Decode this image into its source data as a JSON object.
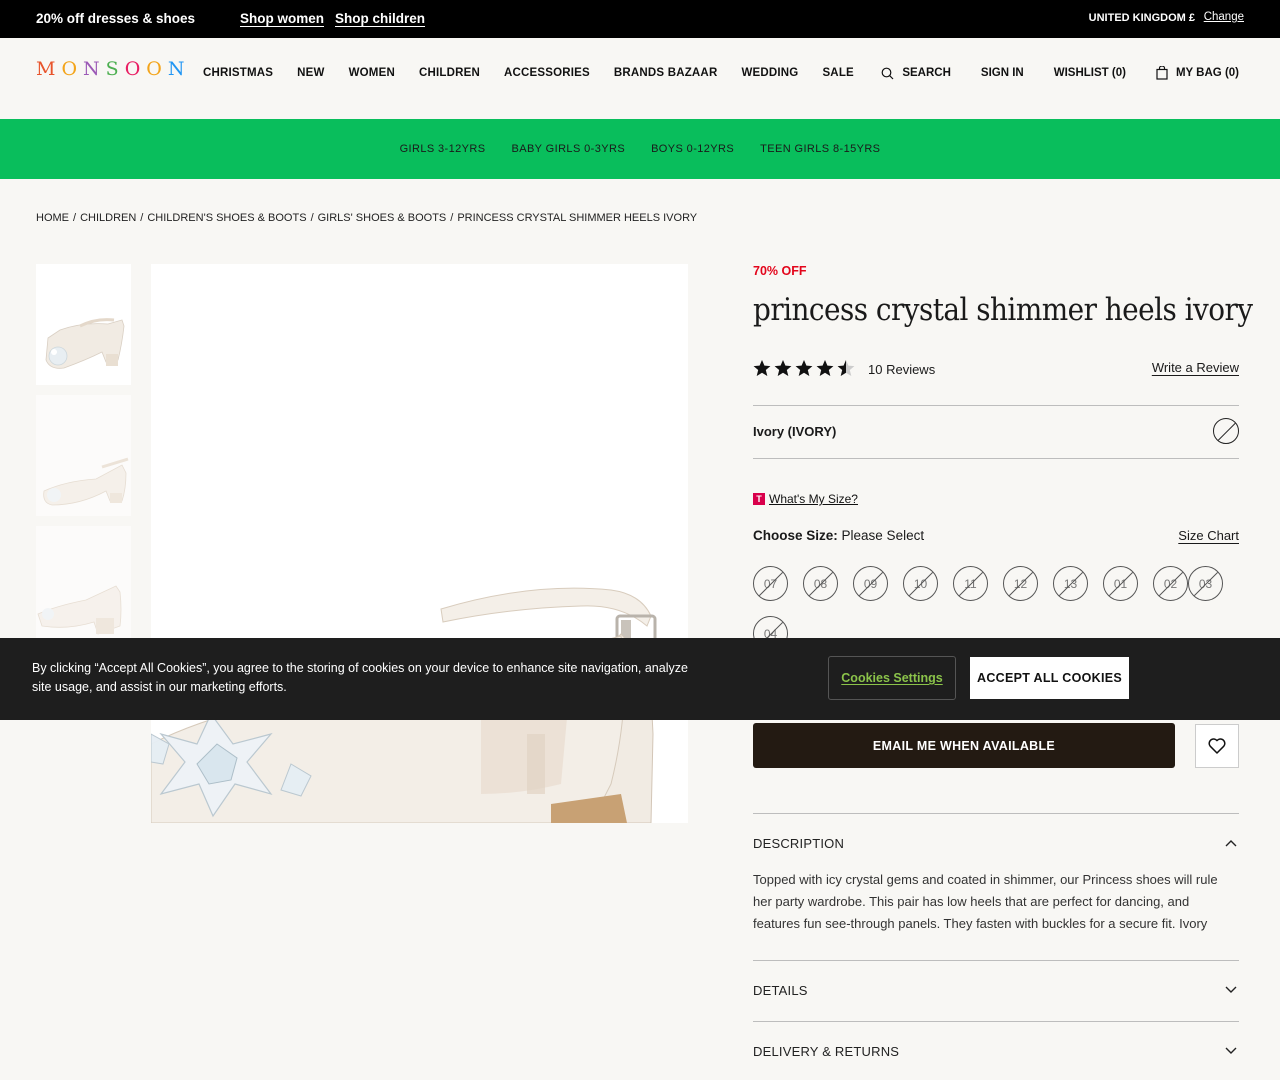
{
  "promo": {
    "offer": "20% off dresses & shoes",
    "shop_women": "Shop women",
    "shop_children": "Shop children",
    "country": "UNITED KINGDOM £",
    "change": "Change"
  },
  "header": {
    "logo_letters": [
      "M",
      "O",
      "N",
      "S",
      "O",
      "O",
      "N"
    ],
    "logo_colors": [
      "#e8542b",
      "#f3a41a",
      "#9b59b6",
      "#4caf50",
      "#e91e63",
      "#f3a41a",
      "#2196f3"
    ],
    "nav": [
      "CHRISTMAS",
      "NEW",
      "WOMEN",
      "CHILDREN",
      "ACCESSORIES",
      "BRANDS BAZAAR",
      "WEDDING",
      "SALE"
    ],
    "search": "SEARCH",
    "sign_in": "SIGN IN",
    "wishlist": "WISHLIST",
    "wishlist_count": "(0)",
    "bag": "MY BAG",
    "bag_count": "(0)"
  },
  "subnav": [
    "GIRLS 3-12YRS",
    "BABY GIRLS 0-3YRS",
    "BOYS 0-12YRS",
    "TEEN GIRLS 8-15YRS"
  ],
  "breadcrumb": [
    "HOME",
    "CHILDREN",
    "CHILDREN'S SHOES & BOOTS",
    "GIRLS' SHOES & BOOTS",
    "PRINCESS CRYSTAL SHIMMER HEELS IVORY"
  ],
  "product": {
    "discount": "70% OFF",
    "title": "princess crystal shimmer heels ivory",
    "rating": 4.5,
    "rating_max": 5,
    "reviews": "10 Reviews",
    "write_review": "Write a Review",
    "colour": "Ivory (IVORY)",
    "whats_my_size": "What's My Size?",
    "size_badge": "T",
    "choose_size_label": "Choose Size:",
    "choose_size_value": "Please Select",
    "size_chart": "Size Chart",
    "sizes": [
      "07",
      "08",
      "09",
      "10",
      "11",
      "12",
      "13",
      "01",
      "02",
      "03",
      "04"
    ],
    "email_button": "EMAIL ME WHEN AVAILABLE",
    "description_title": "DESCRIPTION",
    "description": "Topped with icy crystal gems and coated in shimmer, our Princess shoes will rule her party wardrobe. This pair has low heels that are perfect for dancing, and features fun see-through panels. They fasten with buckles for a secure fit. Ivory",
    "details_title": "DETAILS",
    "delivery_title": "DELIVERY & RETURNS"
  },
  "cookie": {
    "text": "By clicking “Accept All Cookies”, you agree to the storing of cookies on your device to enhance site navigation, analyze site usage, and assist in our marketing efforts.",
    "settings": "Cookies Settings",
    "accept": "ACCEPT ALL COOKIES"
  },
  "colors": {
    "subnav_bg": "#09be5c",
    "discount": "#e3051b",
    "cta_bg": "#231a12",
    "cookie_bg": "#1e1e1e",
    "cookie_link": "#8bc34a"
  }
}
